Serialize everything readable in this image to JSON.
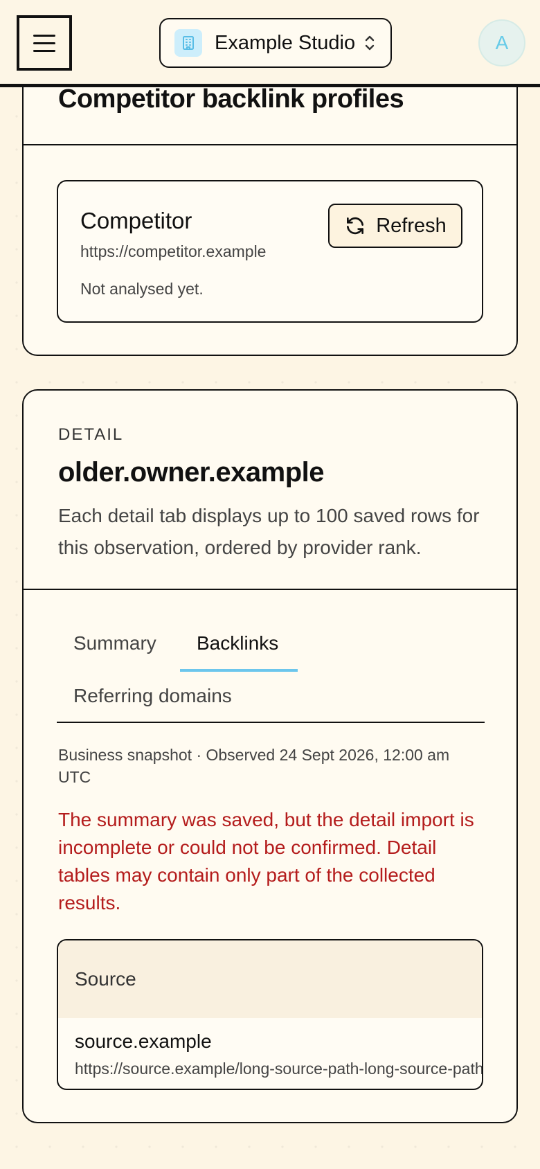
{
  "header": {
    "workspace_name": "Example Studio",
    "avatar_initial": "A",
    "colors": {
      "accent": "#6cc6ec",
      "avatar_bg": "#e6f2ee",
      "workspace_icon_bg": "#cdeefb"
    }
  },
  "competitor_section": {
    "title": "Competitor backlink profiles",
    "competitor": {
      "name": "Competitor",
      "url": "https://competitor.example",
      "status": "Not analysed yet."
    },
    "refresh_label": "Refresh"
  },
  "detail": {
    "kicker": "DETAIL",
    "title": "older.owner.example",
    "description": "Each detail tab displays up to 100 saved rows for this observation, ordered by provider rank.",
    "tabs": [
      {
        "label": "Summary",
        "active": false
      },
      {
        "label": "Backlinks",
        "active": true
      },
      {
        "label": "Referring domains",
        "active": false
      }
    ],
    "snapshot": "Business snapshot · Observed 24 Sept 2026, 12:00 am UTC",
    "warning": "The summary was saved, but the detail import is incomplete or could not be confirmed. Detail tables may contain only part of the collected results.",
    "warning_color": "#b41c1c",
    "table": {
      "header": "Source",
      "rows": [
        {
          "domain": "source.example",
          "url": "https://source.example/long-source-path-long-source-path"
        }
      ]
    }
  }
}
